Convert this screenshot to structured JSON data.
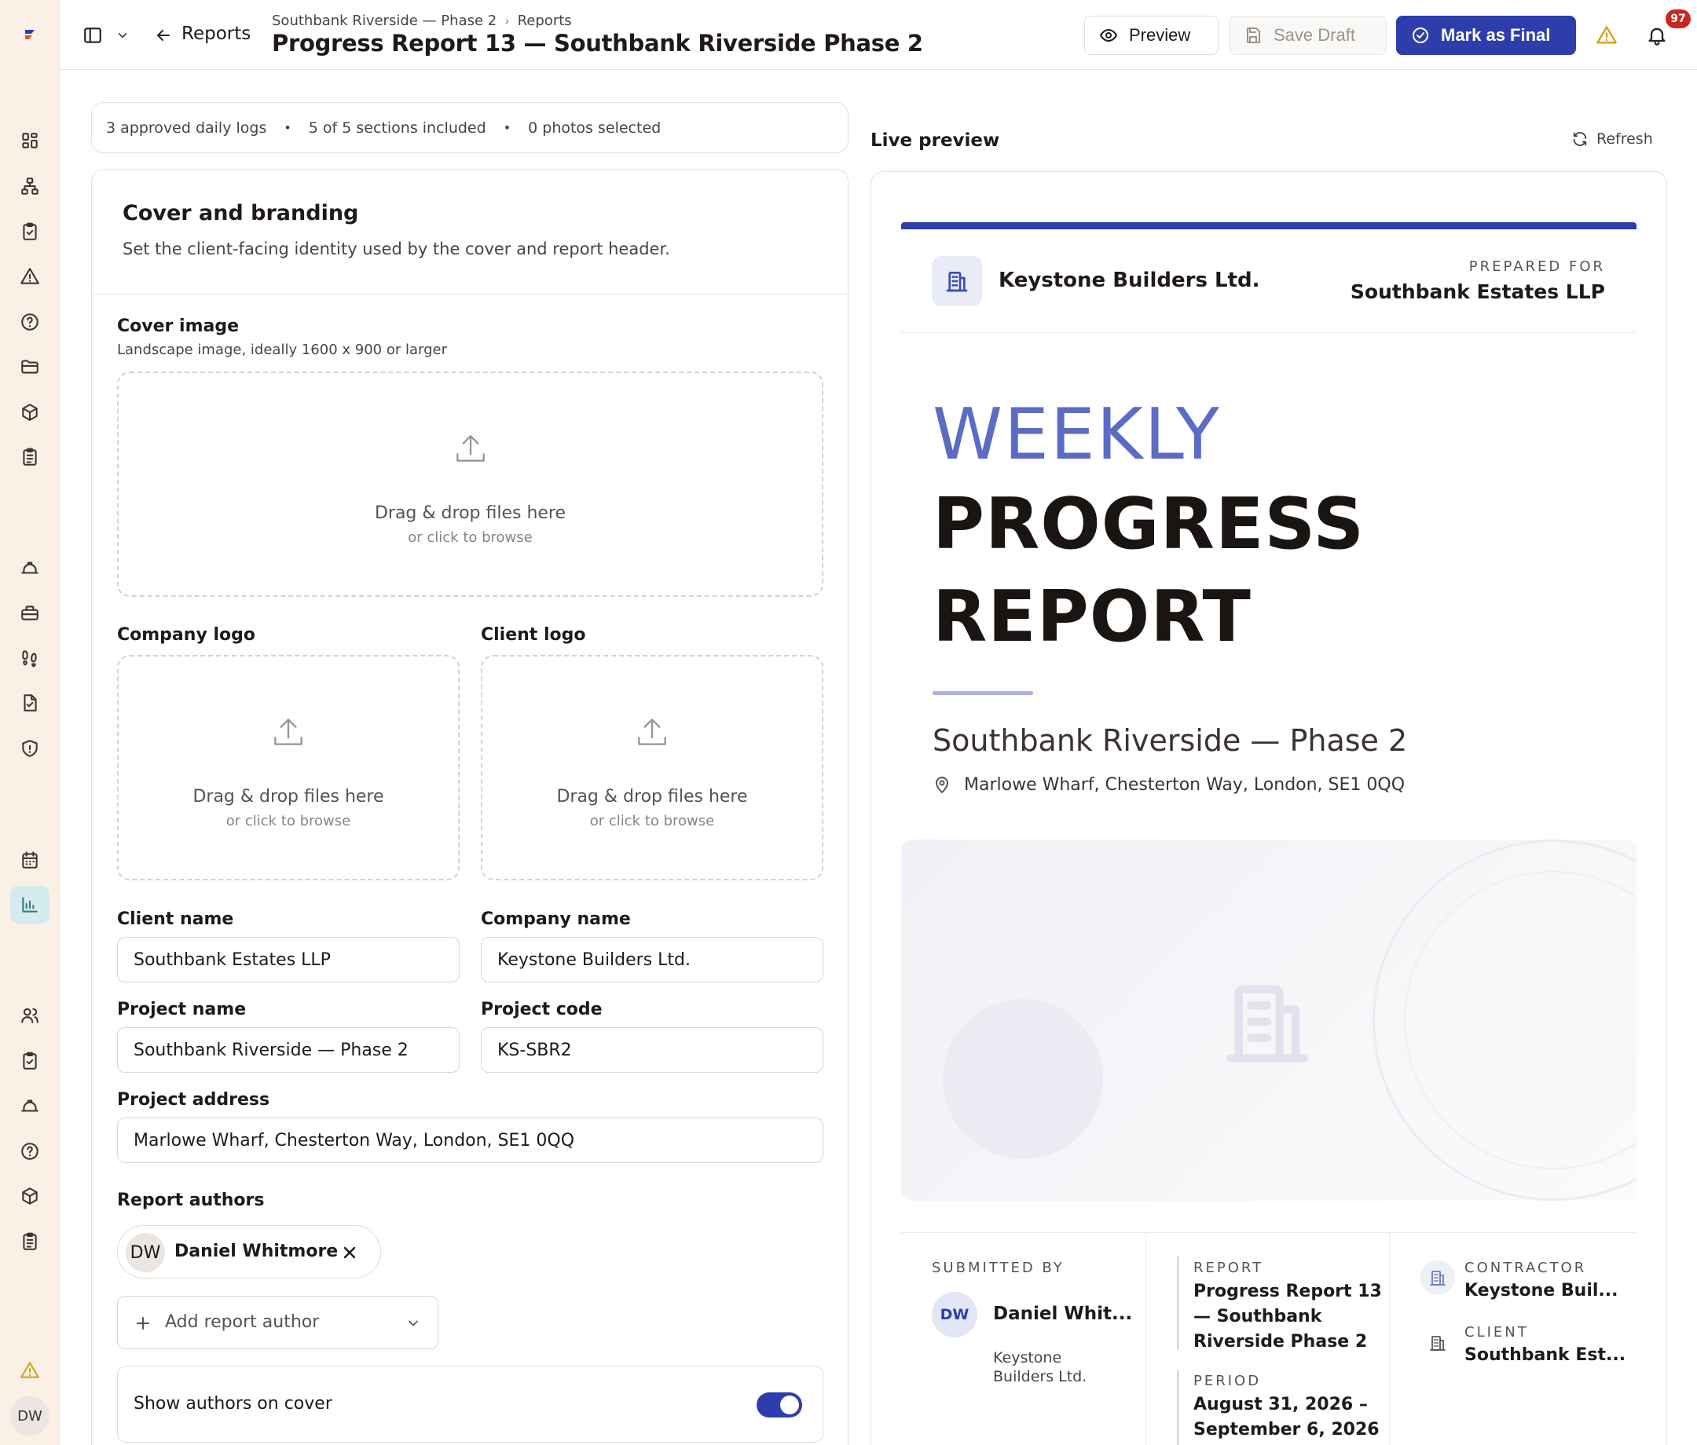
{
  "header": {
    "back_label": "Reports",
    "breadcrumb": [
      "Southbank Riverside — Phase 2",
      "Reports"
    ],
    "title": "Progress Report 13 — Southbank Riverside Phase 2",
    "preview_label": "Preview",
    "save_draft_label": "Save Draft",
    "mark_final_label": "Mark as Final",
    "notification_count": "97"
  },
  "sidebar": {
    "user_initials": "DW",
    "icons": [
      "dashboard-icon",
      "org-chart-icon",
      "checklist-icon",
      "warning-icon",
      "help-icon",
      "folder-icon",
      "package-icon",
      "clipboard-icon",
      "hard-hat-icon",
      "toolbox-icon",
      "footprints-icon",
      "file-check-icon",
      "shield-icon",
      "calendar-icon",
      "bar-chart-icon",
      "users-icon",
      "clipboard-check-icon",
      "hard-hat-icon",
      "help-icon",
      "package-icon",
      "clipboard-icon",
      "alert-icon"
    ],
    "active_item": "bar-chart-icon"
  },
  "summary": {
    "logs": "3 approved daily logs",
    "sections": "5 of 5 sections included",
    "photos": "0 photos selected"
  },
  "form": {
    "title": "Cover and branding",
    "subtitle": "Set the client-facing identity used by the cover and report header.",
    "cover_image": {
      "label": "Cover image",
      "hint": "Landscape image, ideally 1600 x 900 or larger"
    },
    "dropzone": {
      "title": "Drag & drop files here",
      "subtitle": "or click to browse"
    },
    "company_logo_label": "Company logo",
    "client_logo_label": "Client logo",
    "client_name": {
      "label": "Client name",
      "value": "Southbank Estates LLP"
    },
    "company_name": {
      "label": "Company name",
      "value": "Keystone Builders Ltd."
    },
    "project_name": {
      "label": "Project name",
      "value": "Southbank Riverside — Phase 2"
    },
    "project_code": {
      "label": "Project code",
      "value": "KS-SBR2"
    },
    "project_address": {
      "label": "Project address",
      "value": "Marlowe Wharf, Chesterton Way, London, SE1 0QQ"
    },
    "authors": {
      "label": "Report authors",
      "items": [
        {
          "initials": "DW",
          "name": "Daniel Whitmore"
        }
      ],
      "add_placeholder": "Add report author"
    },
    "show_authors": {
      "label": "Show authors on cover",
      "enabled": true
    }
  },
  "preview": {
    "label": "Live preview",
    "refresh_label": "Refresh",
    "company": "Keystone Builders Ltd.",
    "prepared_for_label": "PREPARED FOR",
    "prepared_for": "Southbank Estates LLP",
    "title_line1": "WEEKLY",
    "title_line2": "PROGRESS",
    "title_line3": "REPORT",
    "project": "Southbank Riverside — Phase 2",
    "address": "Marlowe Wharf, Chesterton Way, London, SE1 0QQ",
    "submitted_by_label": "SUBMITTED BY",
    "submitter_initials": "DW",
    "submitter_name": "Daniel Whit...",
    "submitter_company": "Keystone Builders Ltd.",
    "report_label": "REPORT",
    "report_value": "Progress Report 13 — Southbank Riverside Phase 2",
    "period_label": "PERIOD",
    "period_value": "August 31, 2026 – September 6, 2026",
    "contractor_label": "CONTRACTOR",
    "contractor_value": "Keystone Buil...",
    "client_label": "CLIENT",
    "client_value": "Southbank Est..."
  },
  "colors": {
    "primary": "#2d3dab",
    "sidebar_bg": "#fbf0e6",
    "active_nav": "#d6ecec",
    "badge": "#c8281f",
    "warning": "#d4a017",
    "accent_light": "#5c6bc4"
  }
}
